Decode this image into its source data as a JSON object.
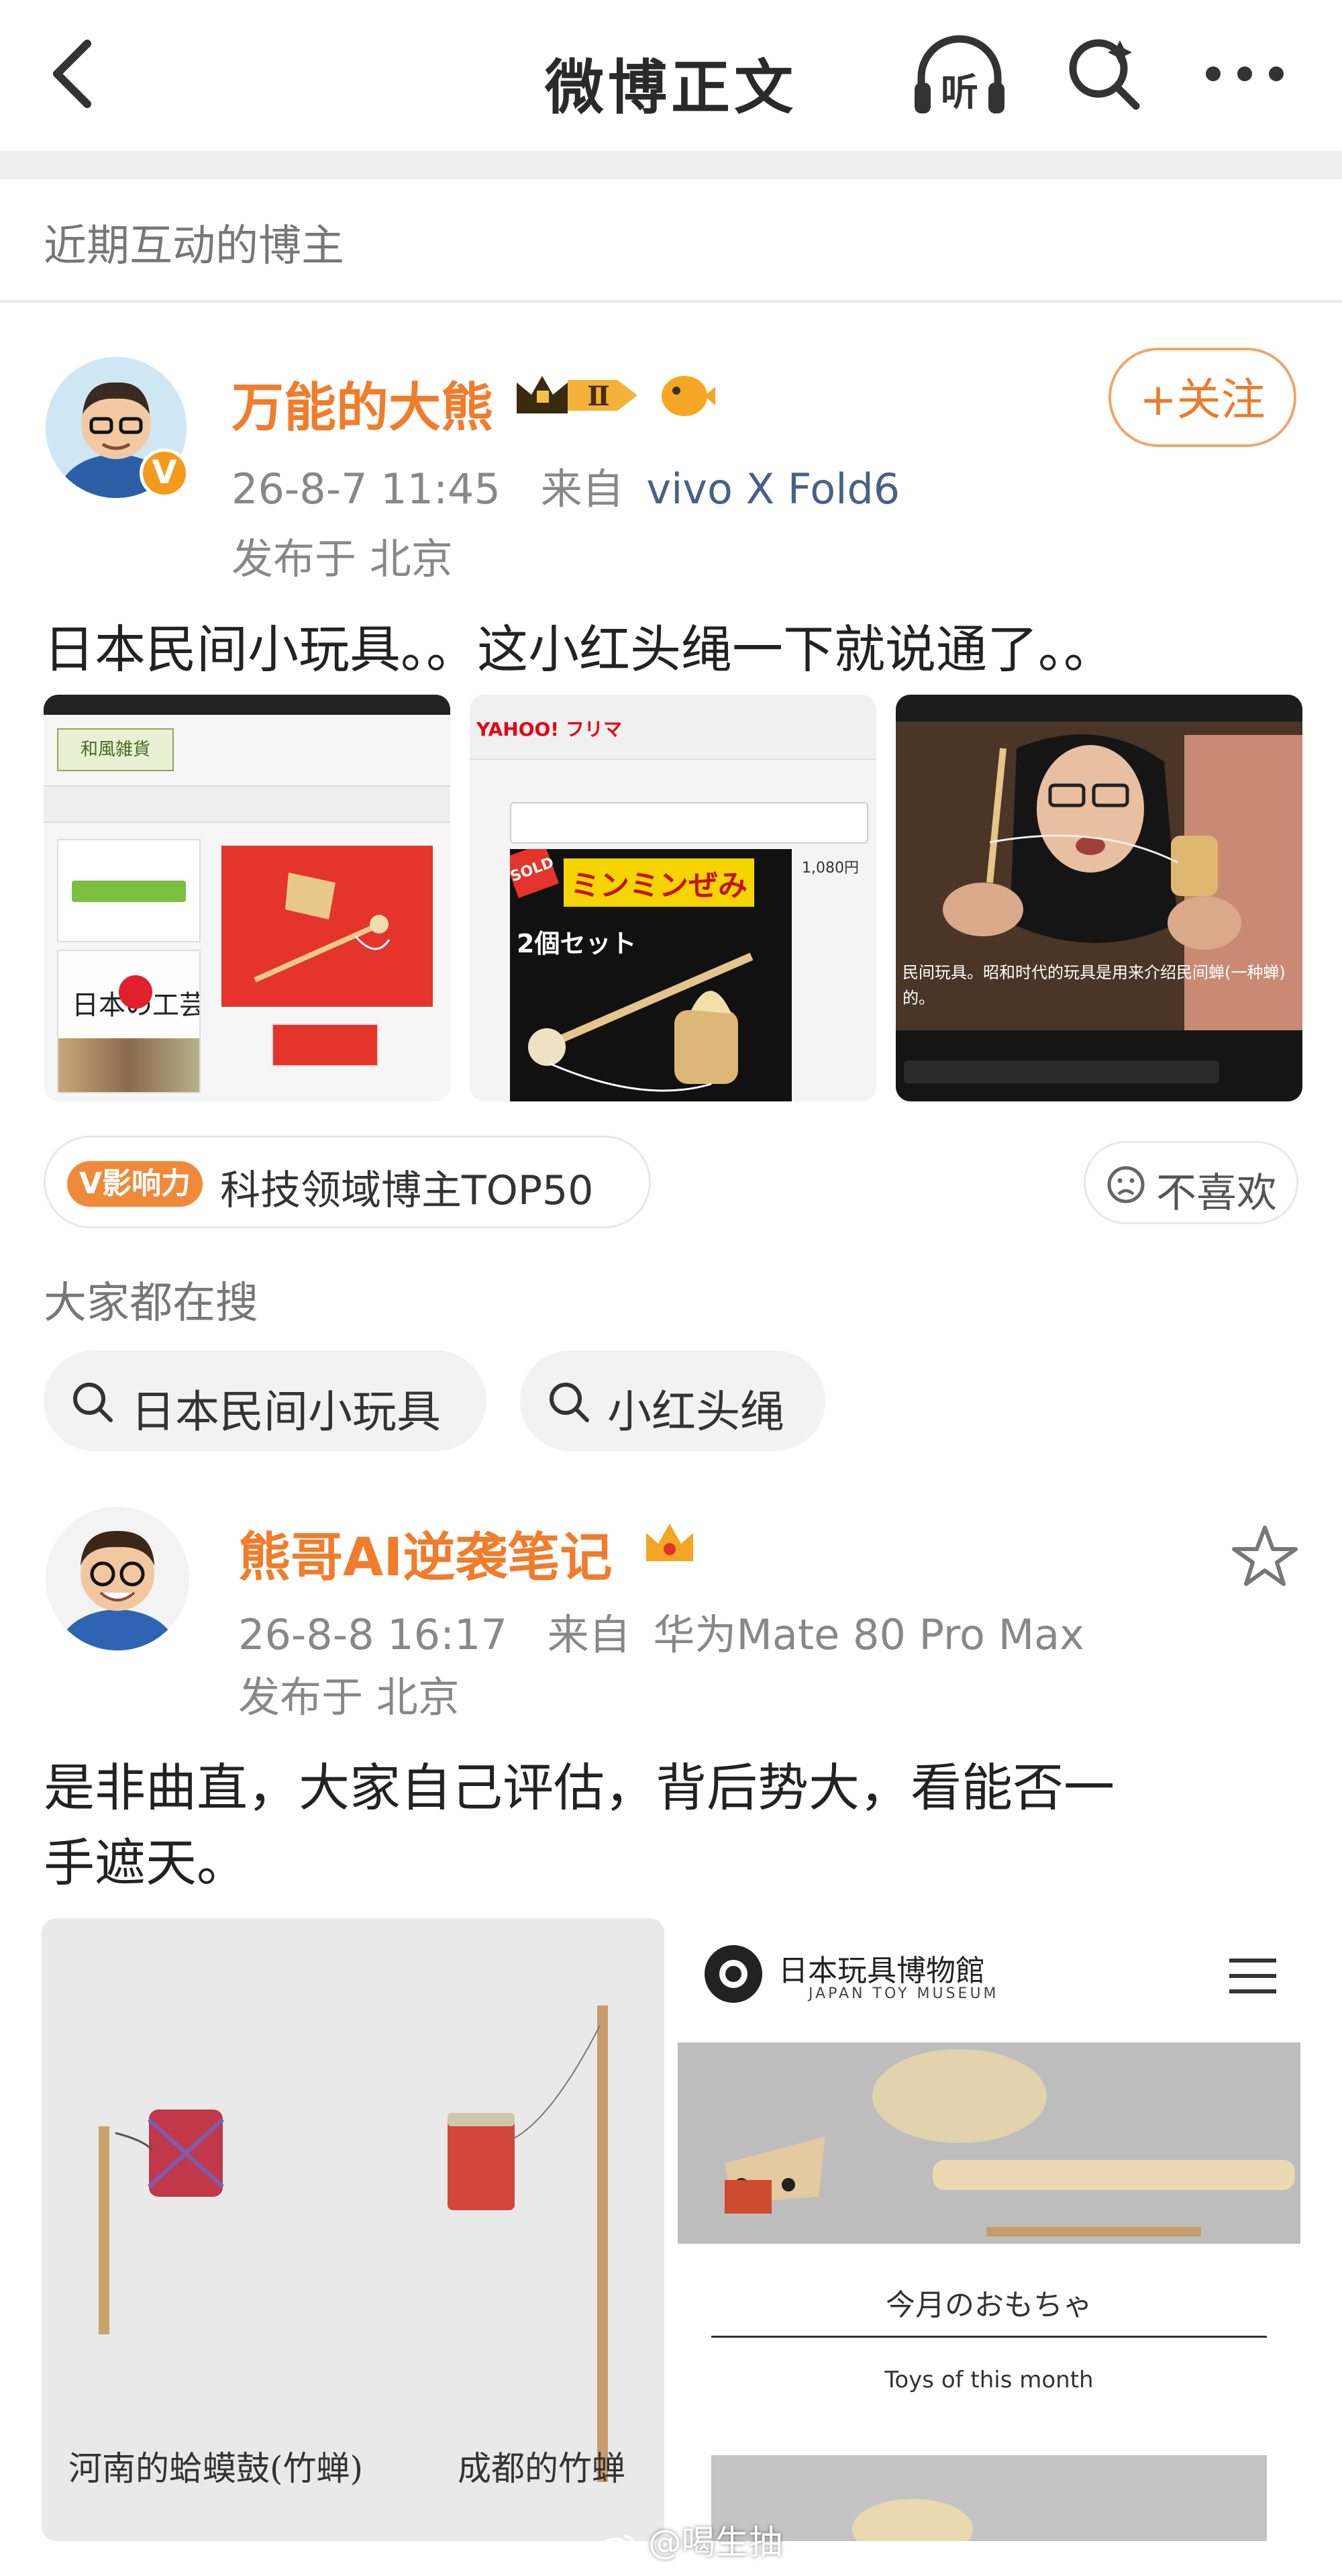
{
  "header": {
    "title": "微博正文",
    "listen_label": "听"
  },
  "section_label": "近期互动的博主",
  "post1": {
    "author": "万能的大熊",
    "badge_level": "Ⅱ",
    "timestamp": "26-8-7 11:45",
    "from_label": "来自",
    "device": "vivo X Fold6",
    "location": "发布于 北京",
    "follow_label": "+关注",
    "text": "日本民间小玩具。。这小红头绳一下就说通了。。",
    "influence_badge": "V影响力",
    "influence_text": "科技领域博主TOP50",
    "dislike_label": "不喜欢",
    "images": [
      {
        "caption_top": "日本の工芸品",
        "brand": "和風雑貨"
      },
      {
        "brand": "YAHOO! フリマ",
        "product": "ミンミンぜみ",
        "set": "2個セット",
        "sold": "SOLD",
        "price": "1,080円"
      },
      {
        "subtitle": "民间玩具。昭和时代的玩具是用来介绍民间蝉(一种蝉)的。"
      }
    ]
  },
  "trending": {
    "label": "大家都在搜",
    "chips": [
      "日本民间小玩具",
      "小红头绳"
    ]
  },
  "post2": {
    "author": "熊哥AI逆袭笔记",
    "timestamp": "26-8-8 16:17",
    "from_label": "来自",
    "device": "华为Mate 80 Pro Max",
    "location": "发布于 北京",
    "text_line1": "是非曲直，大家自己评估，背后势大，看能否一",
    "text_line2": "手遮天。",
    "image1_caption_left": "河南的蛤蟆鼓(竹蝉)",
    "image1_caption_right": "成都的竹蝉",
    "museum_title": "日本玩具博物館",
    "museum_subtitle": "JAPAN TOY MUSEUM",
    "museum_section_jp": "今月のおもちゃ",
    "museum_section_en": "Toys of this month"
  },
  "watermark": "@喝生抽",
  "colors": {
    "accent_orange": "#f07c2c",
    "meta_gray": "#888888",
    "device_blue": "#48608a"
  }
}
